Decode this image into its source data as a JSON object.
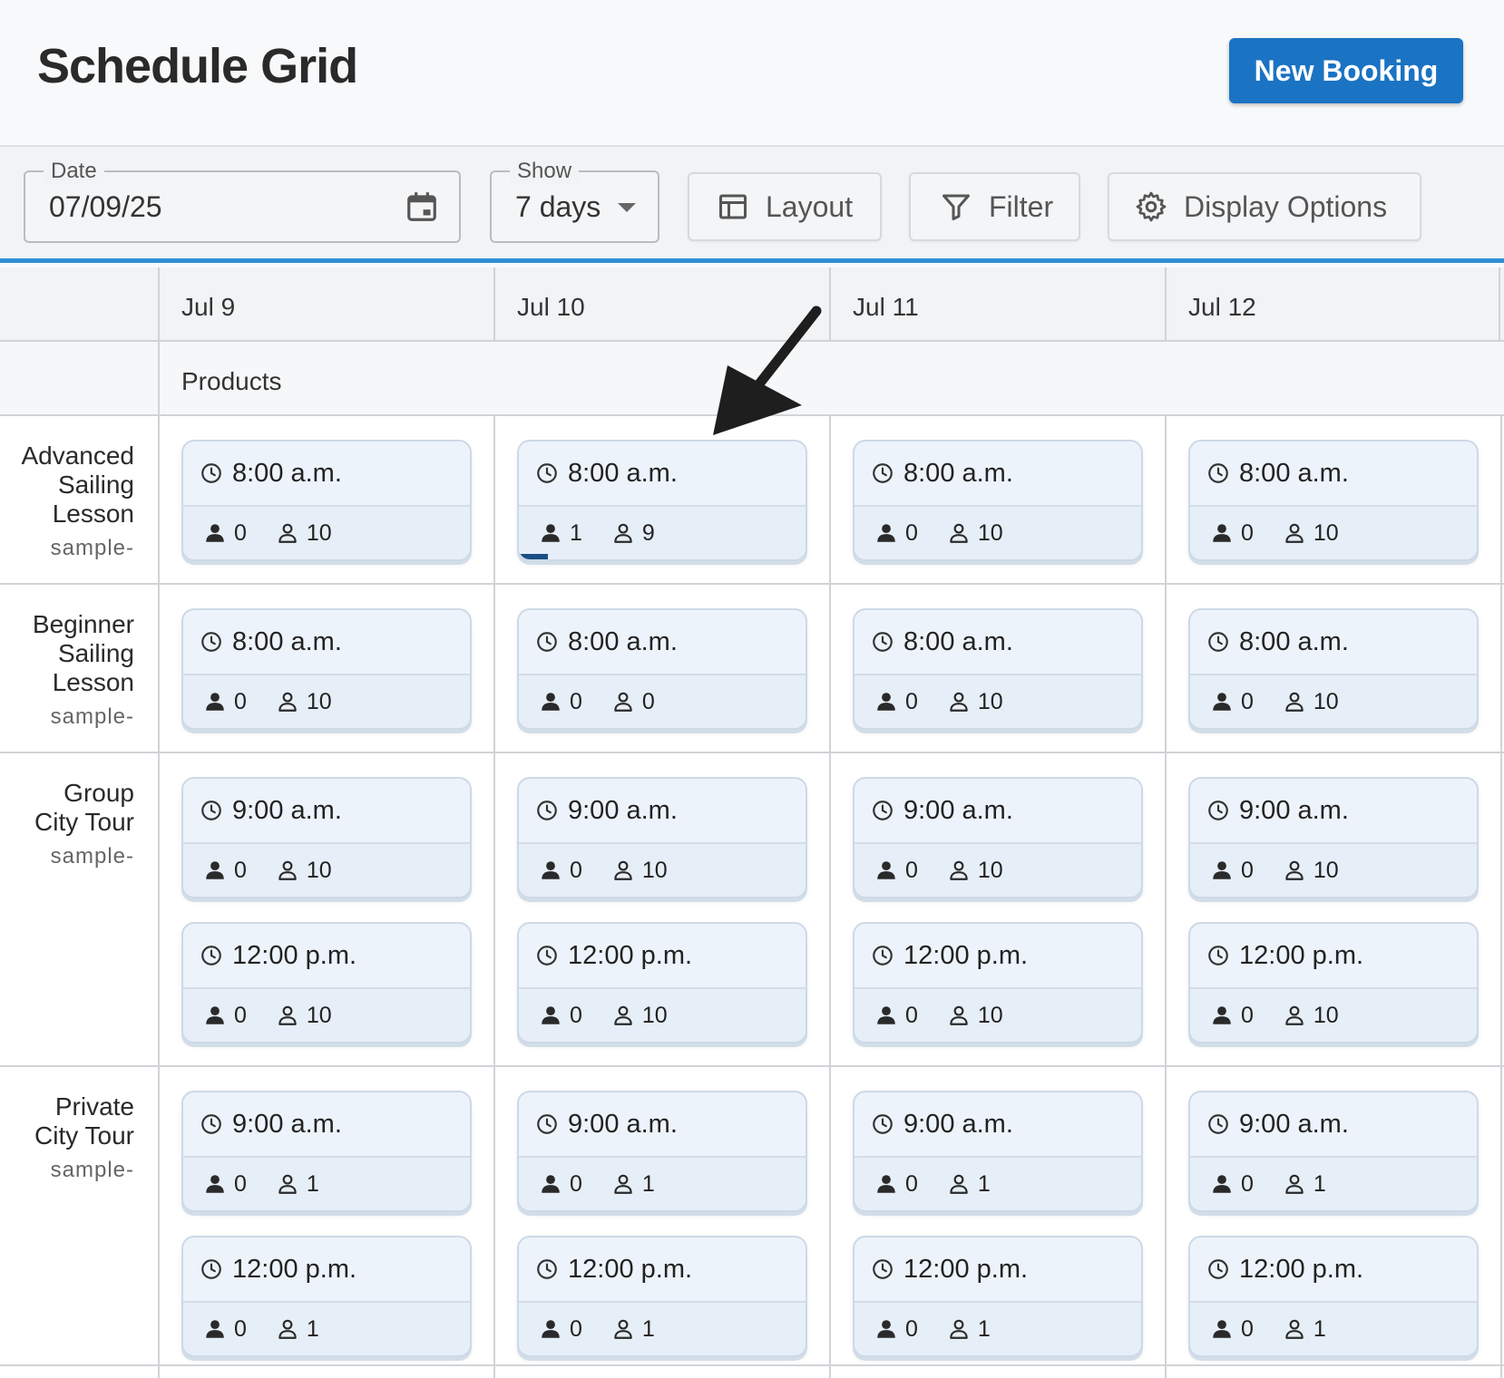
{
  "header": {
    "title": "Schedule Grid",
    "new_booking_label": "New Booking"
  },
  "toolbar": {
    "date": {
      "label": "Date",
      "value": "07/09/25"
    },
    "show": {
      "label": "Show",
      "value": "7 days"
    },
    "layout_label": "Layout",
    "filter_label": "Filter",
    "display_options_label": "Display Options"
  },
  "columns": [
    "Jul 9",
    "Jul 10",
    "Jul 11",
    "Jul 12"
  ],
  "products_header": "Products",
  "rows": [
    {
      "name": [
        "Advanced",
        "Sailing",
        "Lesson"
      ],
      "code": "sample-",
      "slots": [
        [
          {
            "time": "8:00 a.m.",
            "booked": "0",
            "available": "10",
            "fill": 0
          }
        ],
        [
          {
            "time": "8:00 a.m.",
            "booked": "1",
            "available": "9",
            "fill": 0.1
          }
        ],
        [
          {
            "time": "8:00 a.m.",
            "booked": "0",
            "available": "10",
            "fill": 0
          }
        ],
        [
          {
            "time": "8:00 a.m.",
            "booked": "0",
            "available": "10",
            "fill": 0
          }
        ]
      ]
    },
    {
      "name": [
        "Beginner",
        "Sailing",
        "Lesson"
      ],
      "code": "sample-",
      "slots": [
        [
          {
            "time": "8:00 a.m.",
            "booked": "0",
            "available": "10",
            "fill": 0
          }
        ],
        [
          {
            "time": "8:00 a.m.",
            "booked": "0",
            "available": "0",
            "fill": 0
          }
        ],
        [
          {
            "time": "8:00 a.m.",
            "booked": "0",
            "available": "10",
            "fill": 0
          }
        ],
        [
          {
            "time": "8:00 a.m.",
            "booked": "0",
            "available": "10",
            "fill": 0
          }
        ]
      ]
    },
    {
      "name": [
        "Group",
        "City Tour"
      ],
      "code": "sample-",
      "slots": [
        [
          {
            "time": "9:00 a.m.",
            "booked": "0",
            "available": "10",
            "fill": 0
          },
          {
            "time": "12:00 p.m.",
            "booked": "0",
            "available": "10",
            "fill": 0
          }
        ],
        [
          {
            "time": "9:00 a.m.",
            "booked": "0",
            "available": "10",
            "fill": 0
          },
          {
            "time": "12:00 p.m.",
            "booked": "0",
            "available": "10",
            "fill": 0
          }
        ],
        [
          {
            "time": "9:00 a.m.",
            "booked": "0",
            "available": "10",
            "fill": 0
          },
          {
            "time": "12:00 p.m.",
            "booked": "0",
            "available": "10",
            "fill": 0
          }
        ],
        [
          {
            "time": "9:00 a.m.",
            "booked": "0",
            "available": "10",
            "fill": 0
          },
          {
            "time": "12:00 p.m.",
            "booked": "0",
            "available": "10",
            "fill": 0
          }
        ]
      ]
    },
    {
      "name": [
        "Private",
        "City Tour"
      ],
      "code": "sample-",
      "slots": [
        [
          {
            "time": "9:00 a.m.",
            "booked": "0",
            "available": "1",
            "fill": 0
          },
          {
            "time": "12:00 p.m.",
            "booked": "0",
            "available": "1",
            "fill": 0
          }
        ],
        [
          {
            "time": "9:00 a.m.",
            "booked": "0",
            "available": "1",
            "fill": 0
          },
          {
            "time": "12:00 p.m.",
            "booked": "0",
            "available": "1",
            "fill": 0
          }
        ],
        [
          {
            "time": "9:00 a.m.",
            "booked": "0",
            "available": "1",
            "fill": 0
          },
          {
            "time": "12:00 p.m.",
            "booked": "0",
            "available": "1",
            "fill": 0
          }
        ],
        [
          {
            "time": "9:00 a.m.",
            "booked": "0",
            "available": "1",
            "fill": 0
          },
          {
            "time": "12:00 p.m.",
            "booked": "0",
            "available": "1",
            "fill": 0
          }
        ]
      ]
    }
  ],
  "colors": {
    "primary": "#1a73c3",
    "accent_line": "#2f8fd8",
    "card_bg": "#edf3fa",
    "progress": "#1a4f85"
  },
  "icons": [
    "calendar-icon",
    "caret-down-icon",
    "layout-icon",
    "filter-icon",
    "gear-icon",
    "clock-icon",
    "person-filled-icon",
    "person-outline-icon",
    "annotation-arrow"
  ]
}
